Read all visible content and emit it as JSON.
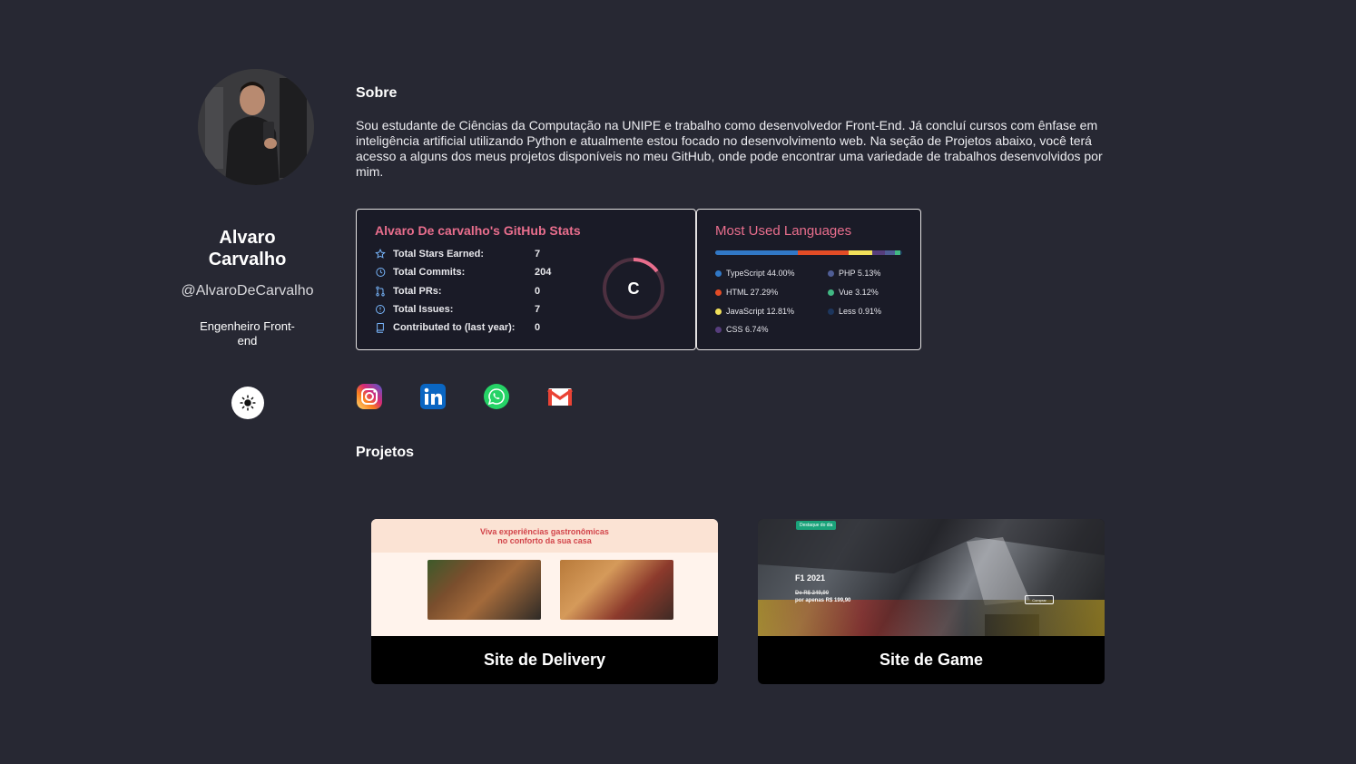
{
  "profile": {
    "name": "Alvaro Carvalho",
    "handle": "@AlvaroDeCarvalho",
    "role": "Engenheiro Front-end"
  },
  "about": {
    "title": "Sobre",
    "text": "Sou estudante de Ciências da Computação na UNIPE e trabalho como desenvolvedor Front-End. Já concluí cursos com ênfase em inteligência artificial utilizando Python e atualmente estou focado no desenvolvimento web. Na seção de Projetos abaixo, você terá acesso a alguns dos meus projetos disponíveis no meu GitHub, onde pode encontrar uma variedade de trabalhos desenvolvidos por mim."
  },
  "github_stats": {
    "title": "Alvaro De carvalho's GitHub Stats",
    "grade": "C",
    "rows": [
      {
        "label": "Total Stars Earned:",
        "value": "7",
        "icon": "star-icon"
      },
      {
        "label": "Total Commits:",
        "value": "204",
        "icon": "history-icon"
      },
      {
        "label": "Total PRs:",
        "value": "0",
        "icon": "pull-request-icon"
      },
      {
        "label": "Total Issues:",
        "value": "7",
        "icon": "issue-icon"
      },
      {
        "label": "Contributed to (last year):",
        "value": "0",
        "icon": "repo-icon"
      }
    ]
  },
  "languages": {
    "title": "Most Used Languages",
    "items": [
      {
        "label": "TypeScript 44.00%",
        "percent": 44.0,
        "color": "#3178c6"
      },
      {
        "label": "HTML 27.29%",
        "percent": 27.29,
        "color": "#e34c26"
      },
      {
        "label": "JavaScript 12.81%",
        "percent": 12.81,
        "color": "#f1e05a"
      },
      {
        "label": "CSS 6.74%",
        "percent": 6.74,
        "color": "#563d7c"
      },
      {
        "label": "PHP 5.13%",
        "percent": 5.13,
        "color": "#4F5D95"
      },
      {
        "label": "Vue 3.12%",
        "percent": 3.12,
        "color": "#41b883"
      },
      {
        "label": "Less 0.91%",
        "percent": 0.91,
        "color": "#1d365d"
      }
    ]
  },
  "social": [
    "instagram-icon",
    "linkedin-icon",
    "whatsapp-icon",
    "gmail-icon"
  ],
  "projects": {
    "title": "Projetos",
    "items": [
      {
        "caption": "Site de Delivery",
        "headline_1": "Viva experiências gastronômicas",
        "headline_2": "no conforto da sua casa"
      },
      {
        "caption": "Site de Game",
        "badge": "Destaque do dia",
        "game": "F1 2021",
        "old_price": "De R$ 249,90",
        "price": "por apenas R$ 199,90",
        "button": "Comprar"
      }
    ]
  },
  "colors": {
    "background": "#272833",
    "card_bg": "#1a1b27",
    "accent_pink": "#e96e8d"
  }
}
